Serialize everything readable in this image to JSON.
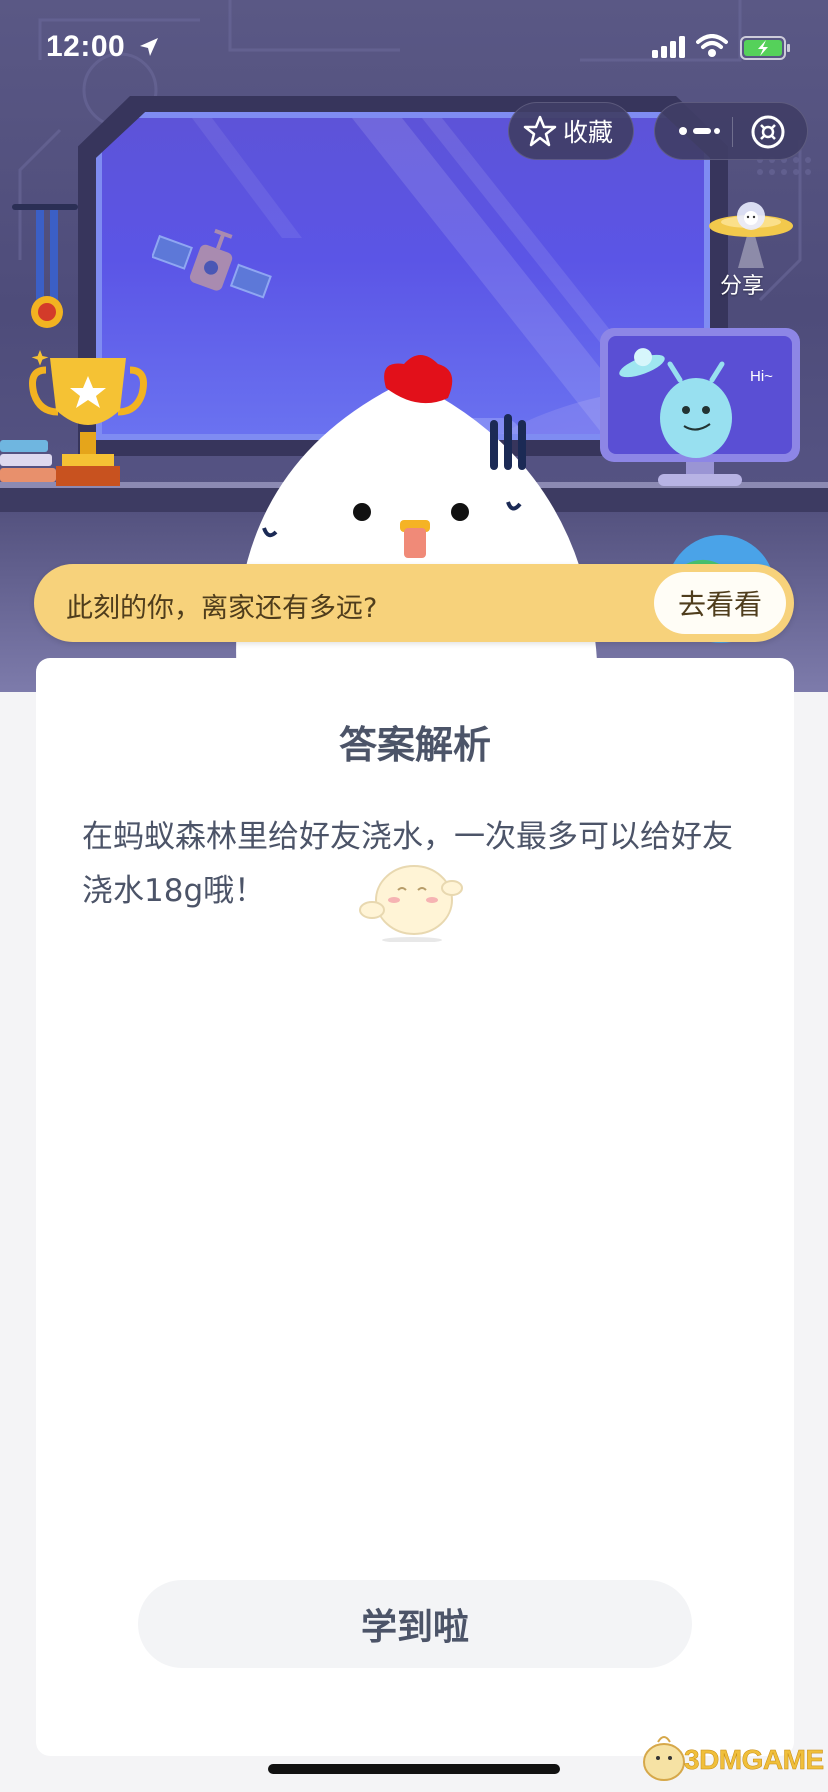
{
  "status_bar": {
    "time": "12:00"
  },
  "header": {
    "favorite_label": "收藏",
    "share_label": "分享"
  },
  "scene": {
    "monitor_text": "Hi~"
  },
  "banner": {
    "text": "此刻的你，离家还有多远?",
    "button_label": "去看看"
  },
  "card": {
    "title": "答案解析",
    "body": "在蚂蚁森林里给好友浇水，一次最多可以给好友浇水18g哦！",
    "confirm_label": "学到啦"
  },
  "watermark": {
    "text": "3DMGAME"
  },
  "colors": {
    "hero_bg": "#5a5885",
    "glass": "#5b55e6",
    "banner": "#f7d27b",
    "card_text": "#4c5468",
    "comb_red": "#e2101a"
  },
  "icons": [
    "location-arrow-icon",
    "signal-icon",
    "wifi-icon",
    "battery-icon",
    "star-icon",
    "more-icon",
    "close-icon",
    "ufo-share-icon"
  ]
}
